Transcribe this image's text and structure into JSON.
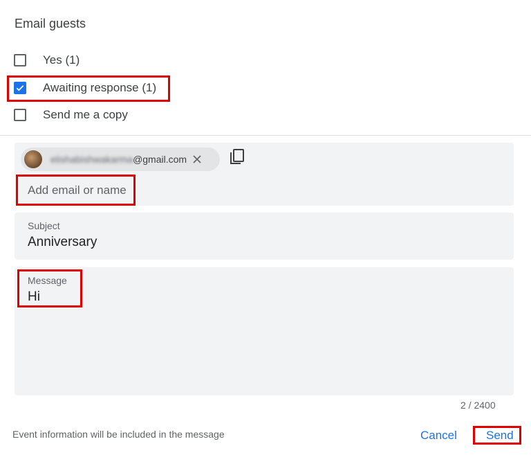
{
  "dialog": {
    "heading": "Email guests",
    "options": [
      {
        "label": "Yes (1)",
        "checked": false
      },
      {
        "label": "Awaiting response (1)",
        "checked": true
      },
      {
        "label": "Send me a copy",
        "checked": false
      }
    ]
  },
  "recipients": {
    "chip": {
      "email_hidden": "elishabishwakarma",
      "email_domain": "@gmail.com"
    },
    "placeholder": "Add email or name"
  },
  "subject": {
    "label": "Subject",
    "value": "Anniversary"
  },
  "message": {
    "label": "Message",
    "value": "Hi",
    "counter": "2 / 2400"
  },
  "footer": {
    "note": "Event information will be included in the message",
    "cancel_label": "Cancel",
    "send_label": "Send"
  },
  "colors": {
    "accent": "#1a73e8",
    "field_bg": "#f1f3f4",
    "highlight": "#e00000"
  }
}
